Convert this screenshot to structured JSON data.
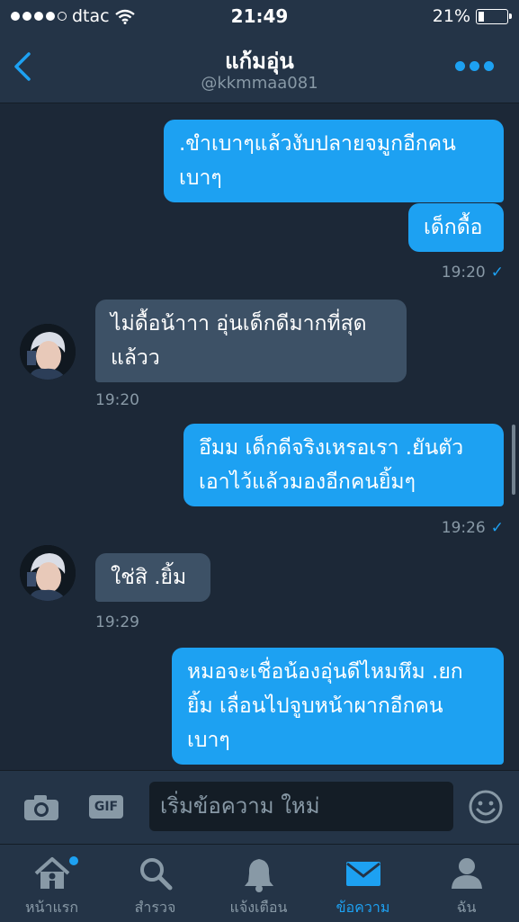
{
  "status_bar": {
    "carrier": "dtac",
    "time": "21:49",
    "battery": "21%"
  },
  "header": {
    "name": "แก้มอุ่น",
    "handle": "@kkmmaa081"
  },
  "messages": [
    {
      "direction": "out",
      "text_lines": [
        ".ขำเบาๆแล้วงับปลายจมูกอีกคน",
        "เบาๆ"
      ]
    },
    {
      "direction": "out",
      "text_lines": [
        "เด็กดื้อ"
      ],
      "time": "19:20"
    },
    {
      "direction": "in",
      "text_lines": [
        "ไม่ดื้อน้าาา อุ่นเด็กดีมากที่สุด",
        "แล้วว"
      ],
      "time": "19:20"
    },
    {
      "direction": "out",
      "text_lines": [
        "อึมม เด็กดีจริงเหรอเรา .ยันตัว",
        "เอาไว้แล้วมองอีกคนยิ้มๆ"
      ],
      "time": "19:26"
    },
    {
      "direction": "in",
      "text_lines": [
        "ใช่สิ .ยิ้ม"
      ],
      "time": "19:29"
    },
    {
      "direction": "out",
      "text_lines": [
        "หมอจะเชื่อน้องอุ่นดีไหมหึม .ยก",
        "ยิ้ม เลื่อนไปจูบหน้าผากอีกคน",
        "เบาๆ"
      ]
    }
  ],
  "composer": {
    "gif_label": "GIF",
    "placeholder": "เริ่มข้อความ ใหม่"
  },
  "tabs": [
    {
      "label": "หน้าแรก",
      "icon": "home-icon"
    },
    {
      "label": "สำรวจ",
      "icon": "search-icon"
    },
    {
      "label": "แจ้งเตือน",
      "icon": "bell-icon"
    },
    {
      "label": "ข้อความ",
      "icon": "mail-icon",
      "active": true
    },
    {
      "label": "ฉัน",
      "icon": "profile-icon"
    }
  ],
  "colors": {
    "accent": "#1da1f2",
    "background": "#1c2837",
    "bar": "#243447",
    "incoming_bubble": "#3d5166",
    "muted": "#8899a6"
  }
}
